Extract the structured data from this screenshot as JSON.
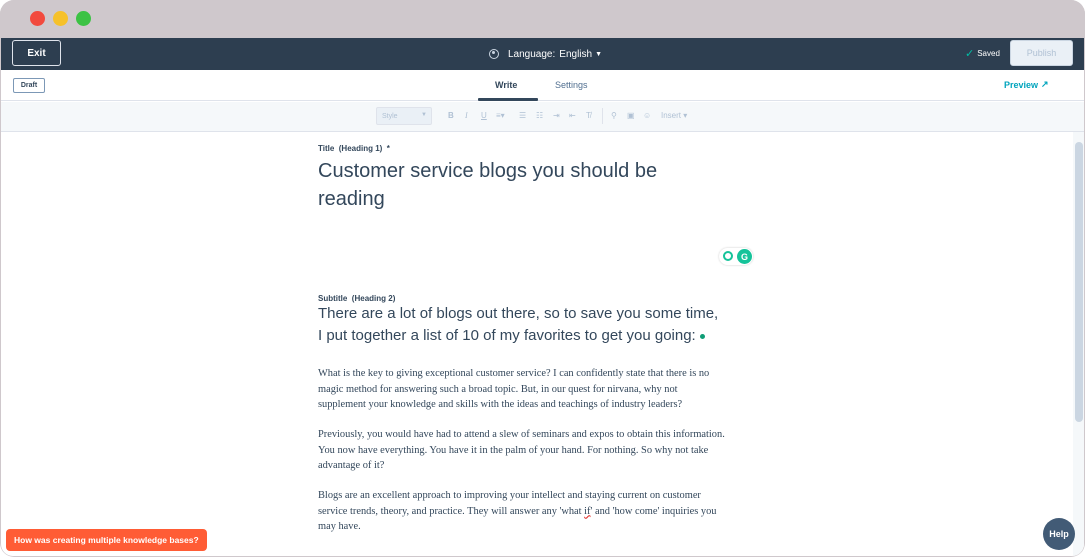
{
  "topbar": {
    "exit_label": "Exit",
    "language_label": "Language:",
    "language_value": "English",
    "saved_label": "Saved",
    "publish_label": "Publish"
  },
  "tabs": {
    "draft_badge": "Draft",
    "write_label": "Write",
    "settings_label": "Settings",
    "preview_label": "Preview"
  },
  "toolbar": {
    "style_placeholder": "Style",
    "insert_label": "Insert",
    "icons": [
      "bold-icon",
      "italic-icon",
      "underline-icon",
      "align-icon",
      "bulleted-list-icon",
      "numbered-list-icon",
      "indent-icon",
      "outdent-icon",
      "clear-format-icon",
      "link-icon",
      "image-icon",
      "emoji-icon"
    ]
  },
  "editor": {
    "title_label": "Title",
    "title_hint": "(Heading 1)",
    "title_required": "*",
    "title_line1": "Customer service blogs you should be",
    "title_line2": "reading",
    "subtitle_label": "Subtitle",
    "subtitle_hint": "(Heading 2)",
    "subtitle_line1": "There are a lot of blogs out there, so to save you some time,",
    "subtitle_line2": "I put together a list of 10 of my favorites to get you going:",
    "p1_line1": "What is the key to giving exceptional customer service? I can confidently state that there is no",
    "p1_line2": "magic method for answering such a broad topic. But, in our quest for nirvana, why not",
    "p1_line3": "supplement your knowledge and skills with the ideas and teachings of industry leaders?",
    "p2_line1": "Previously, you would have had to attend a slew of seminars and expos to obtain this information.",
    "p2_line2": "You now have everything. You have it in the palm of your hand. For nothing. So why not take",
    "p2_line3": "advantage of it?",
    "p3_line1": "Blogs are an excellent approach to improving your intellect and staying current on customer",
    "p3_line2a": "service trends, theory, and practice. They will answer any 'what ",
    "p3_line2_spell": "if",
    "p3_line2b": "' and 'how come' inquiries you",
    "p3_line3": "may have."
  },
  "widgets": {
    "grammarly_letter": "G",
    "feedback_label": "How was creating multiple knowledge bases?",
    "help_label": "Help"
  },
  "colors": {
    "topbar_bg": "#2d3e50",
    "accent_teal": "#00a4bd",
    "feedback_orange": "#ff5c35",
    "help_bg": "#425b76",
    "grammarly_green": "#15c39a"
  }
}
